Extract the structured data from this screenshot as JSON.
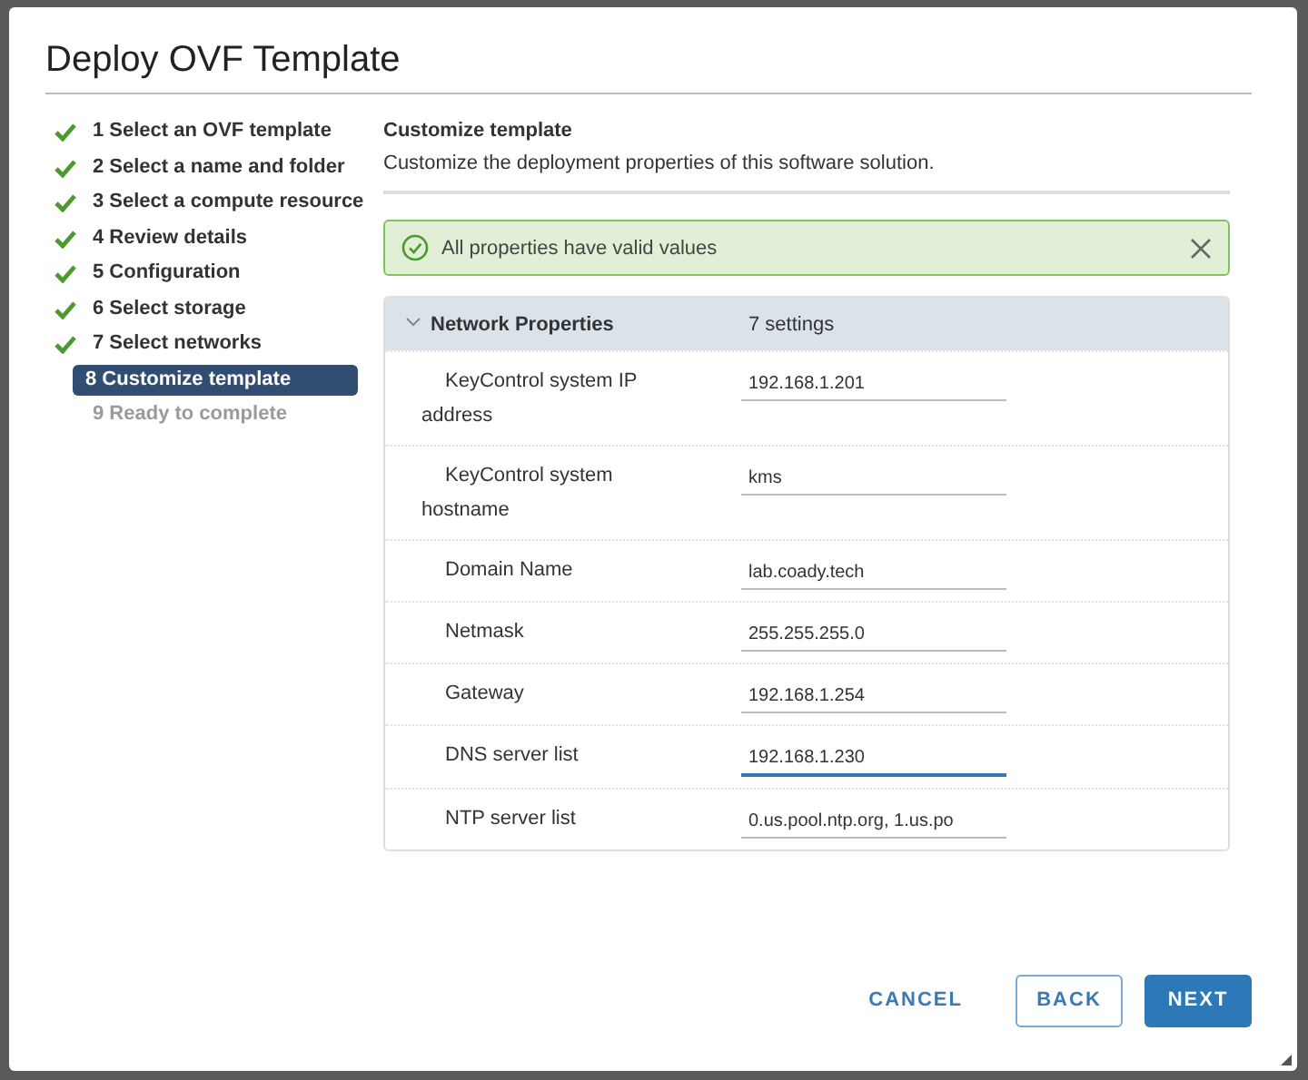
{
  "window": {
    "title": "Deploy OVF Template"
  },
  "steps": [
    {
      "label": "1 Select an OVF template",
      "done": true,
      "selected": false,
      "disabled": false
    },
    {
      "label": "2 Select a name and folder",
      "done": true,
      "selected": false,
      "disabled": false
    },
    {
      "label": "3 Select a compute resource",
      "done": true,
      "selected": false,
      "disabled": false
    },
    {
      "label": "4 Review details",
      "done": true,
      "selected": false,
      "disabled": false
    },
    {
      "label": "5 Configuration",
      "done": true,
      "selected": false,
      "disabled": false
    },
    {
      "label": "6 Select storage",
      "done": true,
      "selected": false,
      "disabled": false
    },
    {
      "label": "7 Select networks",
      "done": true,
      "selected": false,
      "disabled": false
    },
    {
      "label": "8 Customize template",
      "done": false,
      "selected": true,
      "disabled": false
    },
    {
      "label": "9 Ready to complete",
      "done": false,
      "selected": false,
      "disabled": true
    }
  ],
  "page": {
    "heading": "Customize template",
    "description": "Customize the deployment properties of this software solution."
  },
  "alert": {
    "kind": "success",
    "message": "All properties have valid values"
  },
  "group": {
    "title": "Network Properties",
    "count": "7 settings",
    "expanded": true,
    "properties": [
      {
        "label": "KeyControl system IP address",
        "value": "192.168.1.201",
        "focused": false
      },
      {
        "label": "KeyControl system hostname",
        "value": "kms",
        "focused": false
      },
      {
        "label": "Domain Name",
        "value": "lab.coady.tech",
        "focused": false
      },
      {
        "label": "Netmask",
        "value": "255.255.255.0",
        "focused": false
      },
      {
        "label": "Gateway",
        "value": "192.168.1.254",
        "focused": false
      },
      {
        "label": "DNS server list",
        "value": "192.168.1.230",
        "focused": true
      },
      {
        "label": "NTP server list",
        "value": "0.us.pool.ntp.org, 1.us.po",
        "focused": false
      }
    ]
  },
  "buttons": [
    {
      "label": "CANCEL",
      "kind": "flat"
    },
    {
      "label": "BACK",
      "kind": "outline"
    },
    {
      "label": "NEXT",
      "kind": "primary"
    }
  ]
}
